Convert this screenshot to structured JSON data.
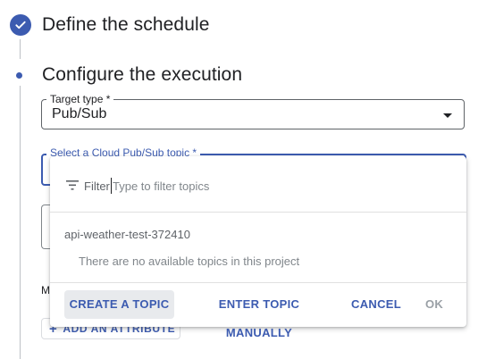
{
  "steps": [
    {
      "title": "Define the schedule",
      "state": "completed"
    },
    {
      "title": "Configure the execution",
      "state": "active"
    }
  ],
  "target_type": {
    "label": "Target type *",
    "value": "Pub/Sub"
  },
  "topic_field": {
    "label": "Select a Cloud Pub/Sub topic *"
  },
  "behind": {
    "partial_label": "M",
    "add_attribute": "ADD AN ATTRIBUTE"
  },
  "dropdown": {
    "filter_label": "Filter",
    "filter_placeholder": "Type to filter topics",
    "project": "api-weather-test-372410",
    "empty_message": "There are no available topics in this project",
    "buttons": {
      "create": "CREATE A TOPIC",
      "manual": "ENTER TOPIC MANUALLY",
      "cancel": "CANCEL",
      "ok": "OK"
    }
  },
  "colors": {
    "accent": "#3c5bb0",
    "border": "#5f6368",
    "muted": "#80868b"
  },
  "icons": {
    "completed": "check-icon",
    "filter": "filter-icon",
    "dropdown": "arrow-drop-down-icon",
    "add": "plus-icon"
  }
}
